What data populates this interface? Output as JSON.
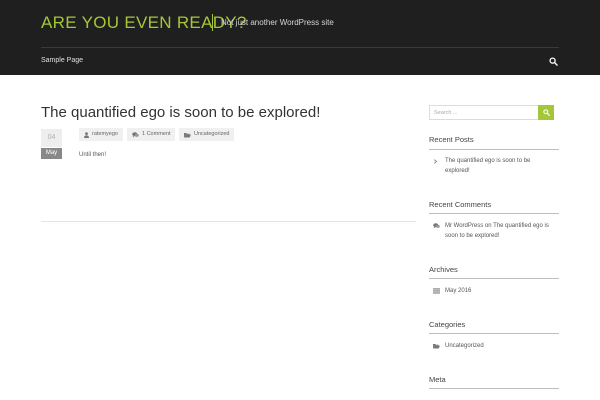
{
  "header": {
    "site_title": "ARE YOU EVEN READY?",
    "tagline": "Not just another WordPress site",
    "nav": [
      {
        "label": "Sample Page"
      }
    ],
    "search_icon": "search-icon"
  },
  "post": {
    "title": "The quantified ego is soon to be explored!",
    "date_day": "04",
    "date_month": "May",
    "meta": {
      "author": "ratemyego",
      "comments": "1 Comment",
      "category": "Uncategorized"
    },
    "content": "Until then!"
  },
  "sidebar": {
    "search": {
      "placeholder": "Search ...",
      "button_icon": "search-icon"
    },
    "recent_posts": {
      "title": "Recent Posts",
      "items": [
        {
          "line1": "The quantified ego is soon to be",
          "line2": "explored!"
        }
      ]
    },
    "recent_comments": {
      "title": "Recent Comments",
      "items": [
        {
          "line1": "Mr WordPress on The quantified ego is",
          "line2": "soon to be explored!"
        }
      ]
    },
    "archives": {
      "title": "Archives",
      "items": [
        {
          "label": "May 2016"
        }
      ]
    },
    "categories": {
      "title": "Categories",
      "items": [
        {
          "label": "Uncategorized"
        }
      ]
    },
    "meta": {
      "title": "Meta"
    }
  },
  "colors": {
    "accent": "#a4c639",
    "header_bg": "#1f1f1f"
  }
}
